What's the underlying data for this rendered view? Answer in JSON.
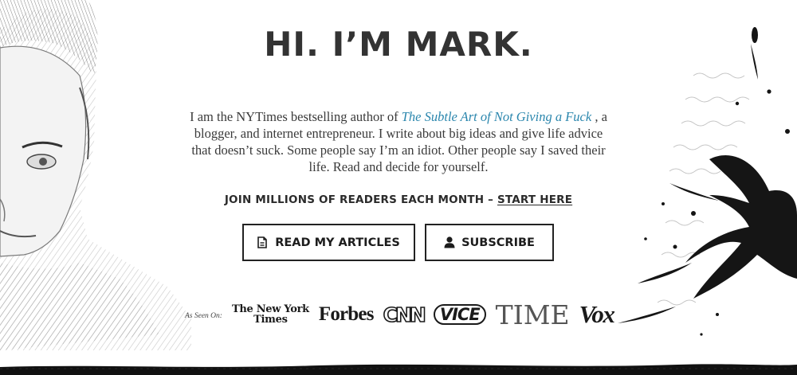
{
  "hero": {
    "title": "HI. I’M MARK.",
    "intro_before": "I am the NYTimes bestselling author of ",
    "book_title": "The Subtle Art of Not Giving a Fuck",
    "intro_after": " , a blogger, and internet entrepreneur. I write about big ideas and give life advice that doesn’t suck. Some people say I’m an idiot. Other people say I saved their life. Read and decide for yourself.",
    "cta_text": "JOIN MILLIONS OF READERS EACH MONTH – ",
    "cta_link": "START HERE"
  },
  "buttons": {
    "articles": {
      "label": "READ MY ARTICLES",
      "icon": "document-icon"
    },
    "subscribe": {
      "label": "SUBSCRIBE",
      "icon": "user-icon"
    }
  },
  "as_seen_on": {
    "label": "As Seen On:",
    "logos": {
      "nyt_line1": "The New York",
      "nyt_line2": "Times",
      "forbes": "Forbes",
      "cnn": "CNN",
      "vice": "VICE",
      "time": "TIME",
      "vox": "Vox"
    }
  },
  "colors": {
    "link": "#2a86ad",
    "text": "#333333",
    "border": "#222222"
  }
}
